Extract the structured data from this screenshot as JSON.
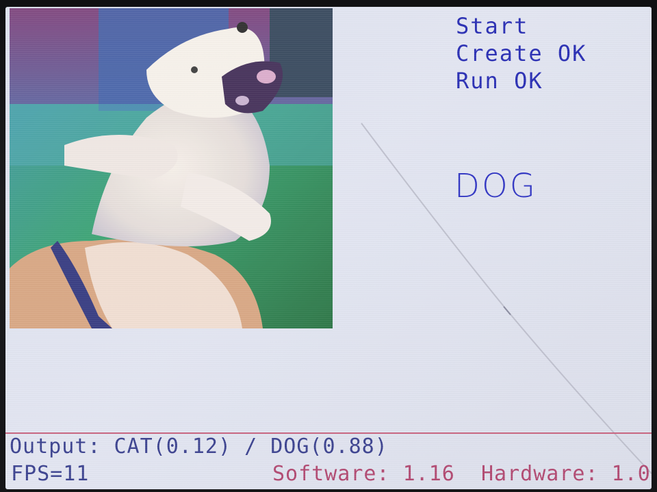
{
  "status": {
    "start": "Start",
    "create": "Create OK",
    "run": "Run OK"
  },
  "result": "DOG",
  "output": "Output: CAT(0.12) / DOG(0.88)",
  "fps": "FPS=11",
  "version": "Software: 1.16  Hardware: 1.00",
  "colors": {
    "status_text": "#2a2fb4",
    "bottom_text": "#3c4390",
    "version_text": "#b24a72",
    "divider": "#c8627e",
    "screen_bg": "#e0e3ef"
  }
}
